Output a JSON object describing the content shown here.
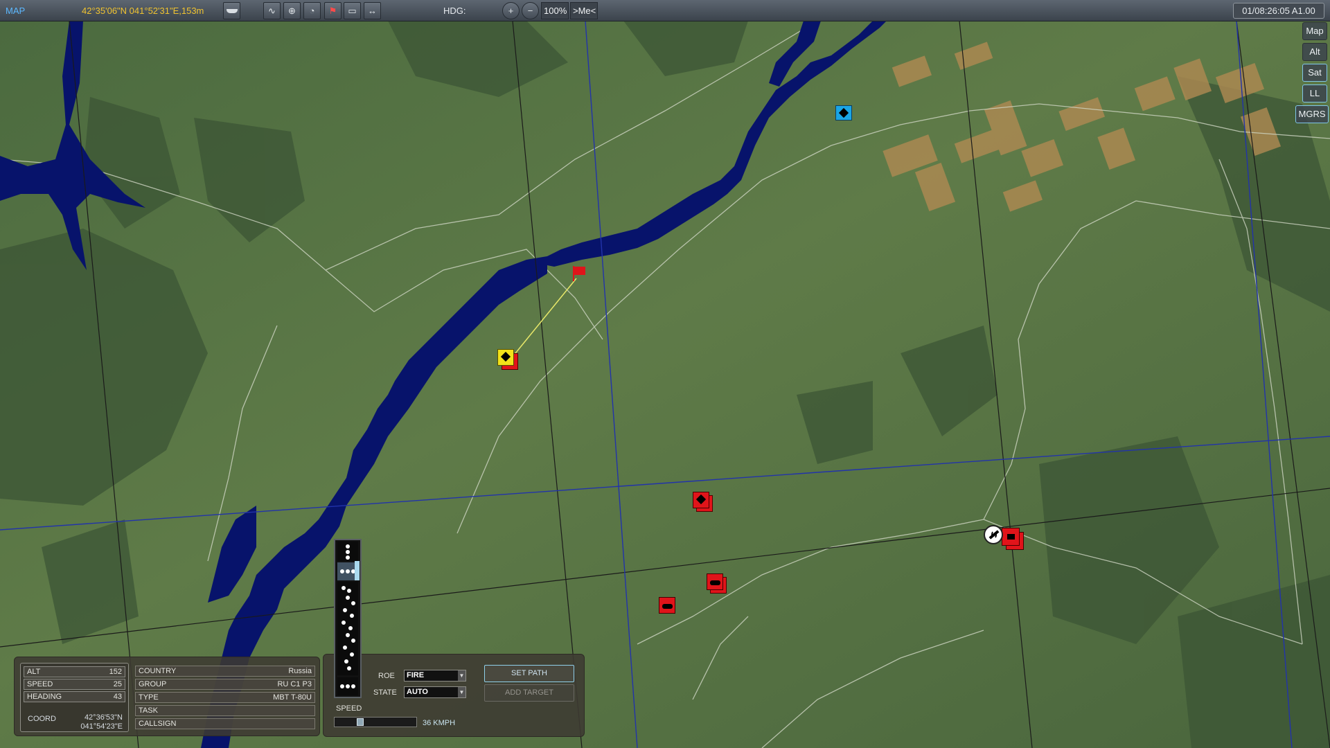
{
  "toolbar": {
    "mode_label": "MAP",
    "cursor_coord": "42°35'06\"N 041°52'31\"E,153m",
    "hdg_label": "HDG:",
    "zoom_level": "100%",
    "me_button": ">Me<",
    "mission_time": "01/08:26:05 A1.00",
    "icons": [
      "ship-icon",
      "route-icon",
      "target-icon",
      "radar-icon",
      "flag-marker-icon",
      "comment-icon",
      "ruler-icon",
      "zoom-in-icon",
      "zoom-out-icon"
    ]
  },
  "map_layers": {
    "buttons": [
      {
        "label": "Map",
        "active": false
      },
      {
        "label": "Alt",
        "active": false
      },
      {
        "label": "Sat",
        "active": true
      },
      {
        "label": "LL",
        "active": true
      },
      {
        "label": "MGRS",
        "active": true
      }
    ]
  },
  "units": [
    {
      "name": "blue-armor-unit",
      "coalition": "blue",
      "color": "#1aa5e6"
    },
    {
      "name": "selected-tank-unit",
      "coalition": "red",
      "selected": true,
      "color": "#f2e21a"
    },
    {
      "name": "red-armor-unit",
      "coalition": "red",
      "color": "#e0141a"
    },
    {
      "name": "red-tank-unit-1",
      "coalition": "red",
      "color": "#e0141a"
    },
    {
      "name": "red-tank-unit-2",
      "coalition": "red",
      "color": "#e0141a"
    },
    {
      "name": "red-airbase-group",
      "coalition": "red",
      "color": "#e0141a"
    },
    {
      "name": "waypoint-flag",
      "coalition": "red",
      "color": "#e0141a"
    }
  ],
  "info": {
    "alt_label": "ALT",
    "alt_value": "152",
    "speed_label": "SPEED",
    "speed_value": "25",
    "heading_label": "HEADING",
    "heading_value": "43",
    "coord_label": "COORD",
    "coord_lat": "42°36'53\"N",
    "coord_lon": "041°54'23\"E",
    "country_label": "COUNTRY",
    "country_value": "Russia",
    "group_label": "GROUP",
    "group_value": "RU C1 P3",
    "type_label": "TYPE",
    "type_value": "MBT T-80U",
    "task_label": "TASK",
    "task_value": "",
    "callsign_label": "CALLSIGN",
    "callsign_value": ""
  },
  "orders": {
    "roe_label": "ROE",
    "roe_value": "FIRE",
    "state_label": "STATE",
    "state_value": "AUTO",
    "speed_label": "SPEED",
    "speed_value": "36 KMPH",
    "speed_fraction": 0.3,
    "set_path_label": "SET PATH",
    "add_target_label": "ADD TARGET"
  }
}
